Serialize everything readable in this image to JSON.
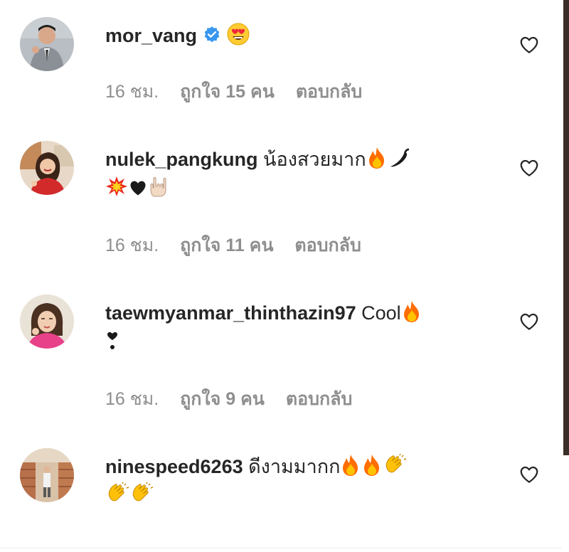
{
  "comments": [
    {
      "username": "mor_vang",
      "verified": true,
      "text": "",
      "emojis": [
        "heart-eyes"
      ],
      "time": "16 ชม.",
      "likes": "ถูกใจ 15 คน",
      "reply": "ตอบกลับ"
    },
    {
      "username": "nulek_pangkung",
      "verified": false,
      "text": "น้องสวยมาก",
      "emojis": [
        "fire",
        "hot-pepper",
        "collision",
        "black-heart",
        "love-you-gesture"
      ],
      "time": "16 ชม.",
      "likes": "ถูกใจ 11 คน",
      "reply": "ตอบกลับ"
    },
    {
      "username": "taewmyanmar_thinthazin97",
      "verified": false,
      "text": "Cool",
      "emojis": [
        "fire",
        "heart-exclamation"
      ],
      "time": "16 ชม.",
      "likes": "ถูกใจ 9 คน",
      "reply": "ตอบกลับ"
    },
    {
      "username": "ninespeed6263",
      "verified": false,
      "text": "ดีงามมากก",
      "emojis": [
        "fire",
        "fire",
        "clapping-hands",
        "clapping-hands",
        "clapping-hands"
      ],
      "time": "",
      "likes": "",
      "reply": ""
    }
  ],
  "colors": {
    "text": "#262626",
    "meta": "#8e8e8e",
    "verified": "#3897f0",
    "fire": "#ff6d00",
    "clap": "#ffc107"
  }
}
